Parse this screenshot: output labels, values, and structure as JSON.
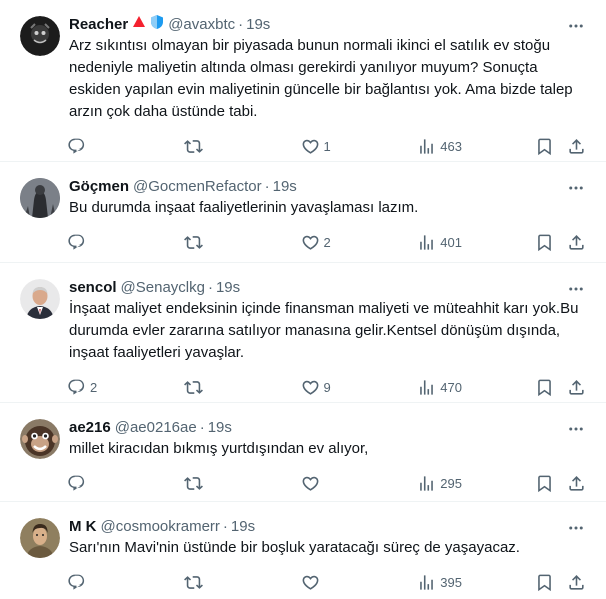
{
  "tweets": [
    {
      "name": "Reacher",
      "handle": "@avaxbtc",
      "dot": "·",
      "time": "19s",
      "text": "Arz sıkıntısı olmayan bir piyasada bunun normali ikinci el satılık ev stoğu nedeniyle maliyetin altında olması gerekirdi yanılıyor muyum? Sonuçta eskiden yapılan evin maliyetinin güncelle bir bağlantısı yok. Ama bizde talep arzın çok daha üstünde tabi.",
      "replies": "",
      "retweets": "",
      "likes": "1",
      "views": "463"
    },
    {
      "name": "Göçmen",
      "handle": "@GocmenRefactor",
      "dot": "·",
      "time": "19s",
      "text": "Bu durumda inşaat faaliyetlerinin yavaşlaması lazım.",
      "replies": "",
      "retweets": "",
      "likes": "2",
      "views": "401"
    },
    {
      "name": "sencol",
      "handle": "@Senayclkg",
      "dot": "·",
      "time": "19s",
      "text": "İnşaat maliyet endeksinin içinde finansman maliyeti ve müteahhit karı yok.Bu durumda evler zararına satılıyor manasına gelir.Kentsel dönüşüm dışında, inşaat faaliyetleri yavaşlar.",
      "replies": "2",
      "retweets": "",
      "likes": "9",
      "views": "470"
    },
    {
      "name": "ae216",
      "handle": "@ae0216ae",
      "dot": "·",
      "time": "19s",
      "text": "millet kiracıdan bıkmış yurtdışından ev alıyor,",
      "replies": "",
      "retweets": "",
      "likes": "",
      "views": "295"
    },
    {
      "name": "M K",
      "handle": "@cosmookramerr",
      "dot": "·",
      "time": "19s",
      "text": "Sarı'nın Mavi'nin üstünde bir boşluk yaratacağı süreç de yaşayacaz.",
      "replies": "",
      "retweets": "",
      "likes": "",
      "views": "395"
    }
  ],
  "icons": {
    "reply": "reply-icon",
    "retweet": "retweet-icon",
    "like": "heart-icon",
    "views": "views-icon",
    "bookmark": "bookmark-icon",
    "share": "share-icon",
    "more": "more-icon"
  },
  "colors": {
    "text": "#0f1419",
    "secondary": "#536471",
    "border": "#eff3f4",
    "badge_red": "#f4212e",
    "badge_blue": "#1d9bf0"
  }
}
